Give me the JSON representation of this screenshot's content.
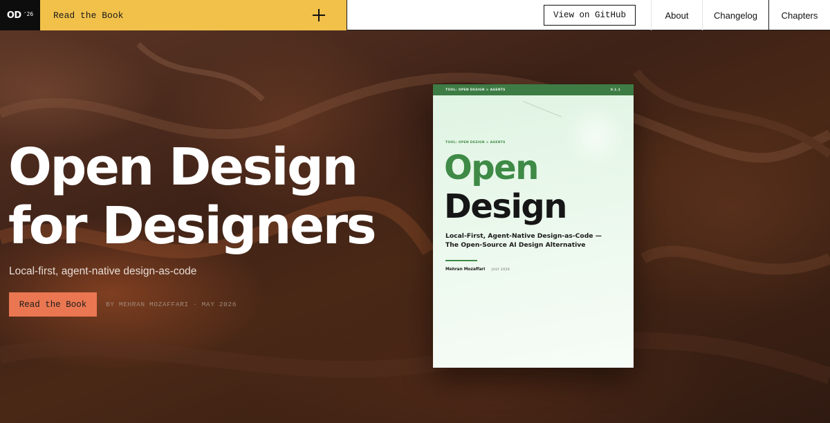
{
  "header": {
    "logo_mark": "OD",
    "logo_year": "'26",
    "read_label": "Read the Book",
    "github_label": "View on GitHub",
    "nav": [
      {
        "label": "About"
      },
      {
        "label": "Changelog"
      },
      {
        "label": "Chapters"
      }
    ]
  },
  "hero": {
    "title_lines": [
      "Open Design",
      "for Designers"
    ],
    "subtitle": "Local-first, agent-native design-as-code",
    "cta_label": "Read the Book",
    "byline": "BY MEHRAN MOZAFFARI · MAY 2026"
  },
  "book": {
    "top_left": "TOOL: OPEN DESIGN × AGENTS",
    "top_right": "0.1.1",
    "tag": "TOOL: OPEN DESIGN × AGENTS",
    "title_word1": "Open",
    "title_word2": "Design",
    "subtitle": "Local-First, Agent-Native Design-as-Code — The Open-Source AI Design Alternative",
    "author": "Mehran Mozaffari",
    "date": "JULY 2026"
  },
  "colors": {
    "accent_yellow": "#f2c14a",
    "cta_orange": "#ea7751",
    "book_green": "#3e8a46"
  },
  "icons": {
    "expand": "plus-icon"
  }
}
